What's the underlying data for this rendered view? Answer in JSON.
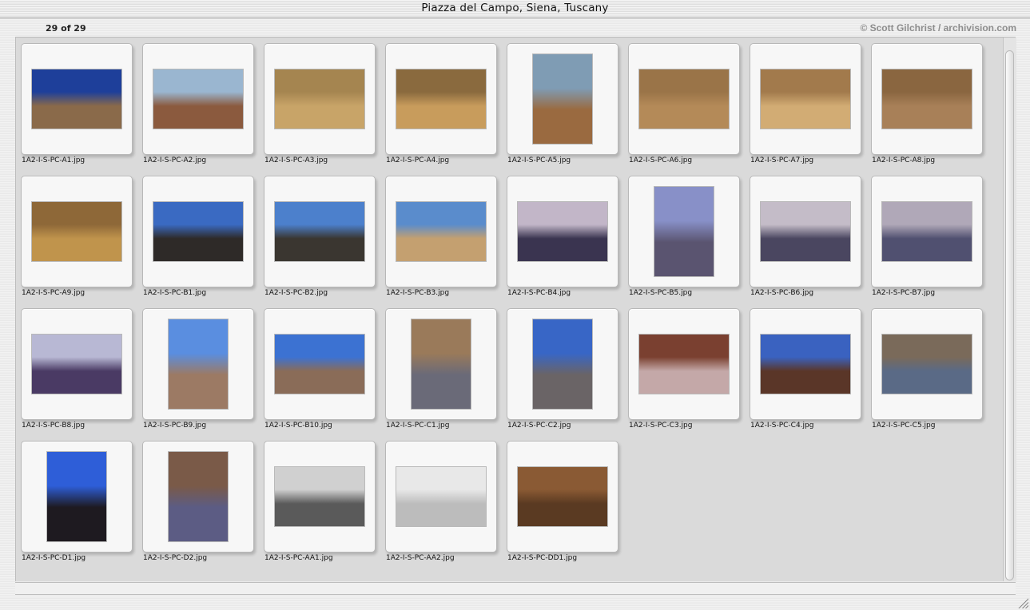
{
  "window": {
    "title": "Piazza del Campo, Siena, Tuscany"
  },
  "header": {
    "count": "29 of 29",
    "copyright": "© Scott Gilchrist / archivision.com"
  },
  "gallery": {
    "items": [
      {
        "filename": "1A2-I-S-PC-A1.jpg",
        "orientation": "landscape",
        "sky": "#1e3f9a",
        "ground": "#8a6a4a"
      },
      {
        "filename": "1A2-I-S-PC-A2.jpg",
        "orientation": "landscape",
        "sky": "#9ab6d0",
        "ground": "#8b5a3e"
      },
      {
        "filename": "1A2-I-S-PC-A3.jpg",
        "orientation": "landscape",
        "sky": "#a58550",
        "ground": "#c8a468"
      },
      {
        "filename": "1A2-I-S-PC-A4.jpg",
        "orientation": "landscape",
        "sky": "#8a6a3e",
        "ground": "#c89c5c"
      },
      {
        "filename": "1A2-I-S-PC-A5.jpg",
        "orientation": "portrait",
        "sky": "#7f9cb4",
        "ground": "#9a6a40"
      },
      {
        "filename": "1A2-I-S-PC-A6.jpg",
        "orientation": "landscape",
        "sky": "#9a7448",
        "ground": "#b48a58"
      },
      {
        "filename": "1A2-I-S-PC-A7.jpg",
        "orientation": "landscape",
        "sky": "#a27a4c",
        "ground": "#d2ac74"
      },
      {
        "filename": "1A2-I-S-PC-A8.jpg",
        "orientation": "landscape",
        "sky": "#8a6640",
        "ground": "#a88058"
      },
      {
        "filename": "1A2-I-S-PC-A9.jpg",
        "orientation": "landscape",
        "sky": "#8e6838",
        "ground": "#c0944c"
      },
      {
        "filename": "1A2-I-S-PC-B1.jpg",
        "orientation": "landscape",
        "sky": "#3a6ac2",
        "ground": "#2e2a28"
      },
      {
        "filename": "1A2-I-S-PC-B2.jpg",
        "orientation": "landscape",
        "sky": "#4c80cc",
        "ground": "#3a3630"
      },
      {
        "filename": "1A2-I-S-PC-B3.jpg",
        "orientation": "landscape",
        "sky": "#5a8ccc",
        "ground": "#c4a070"
      },
      {
        "filename": "1A2-I-S-PC-B4.jpg",
        "orientation": "landscape",
        "sky": "#c2b6c8",
        "ground": "#3a3450"
      },
      {
        "filename": "1A2-I-S-PC-B5.jpg",
        "orientation": "portrait",
        "sky": "#8890c8",
        "ground": "#5a5470"
      },
      {
        "filename": "1A2-I-S-PC-B6.jpg",
        "orientation": "landscape",
        "sky": "#c4bcc8",
        "ground": "#4a4660"
      },
      {
        "filename": "1A2-I-S-PC-B7.jpg",
        "orientation": "landscape",
        "sky": "#b0a8b8",
        "ground": "#505070"
      },
      {
        "filename": "1A2-I-S-PC-B8.jpg",
        "orientation": "landscape",
        "sky": "#b8b8d4",
        "ground": "#4a3a64"
      },
      {
        "filename": "1A2-I-S-PC-B9.jpg",
        "orientation": "portrait",
        "sky": "#5a8ee0",
        "ground": "#9c7a64"
      },
      {
        "filename": "1A2-I-S-PC-B10.jpg",
        "orientation": "landscape",
        "sky": "#3c72d2",
        "ground": "#8a6c58"
      },
      {
        "filename": "1A2-I-S-PC-C1.jpg",
        "orientation": "portrait",
        "sky": "#9a7a5a",
        "ground": "#6a6a78"
      },
      {
        "filename": "1A2-I-S-PC-C2.jpg",
        "orientation": "portrait",
        "sky": "#3866c6",
        "ground": "#6a6466"
      },
      {
        "filename": "1A2-I-S-PC-C3.jpg",
        "orientation": "landscape",
        "sky": "#7a4030",
        "ground": "#c4a8a8"
      },
      {
        "filename": "1A2-I-S-PC-C4.jpg",
        "orientation": "landscape",
        "sky": "#3a62c0",
        "ground": "#5a3628"
      },
      {
        "filename": "1A2-I-S-PC-C5.jpg",
        "orientation": "landscape",
        "sky": "#7a6a5a",
        "ground": "#5a6a86"
      },
      {
        "filename": "1A2-I-S-PC-D1.jpg",
        "orientation": "portrait",
        "sky": "#2e5ed8",
        "ground": "#1e1a20"
      },
      {
        "filename": "1A2-I-S-PC-D2.jpg",
        "orientation": "portrait",
        "sky": "#7a5a48",
        "ground": "#5c5c84"
      },
      {
        "filename": "1A2-I-S-PC-AA1.jpg",
        "orientation": "landscape",
        "sky": "#d0d0d0",
        "ground": "#5a5a5a"
      },
      {
        "filename": "1A2-I-S-PC-AA2.jpg",
        "orientation": "landscape",
        "sky": "#e8e8e8",
        "ground": "#bcbcbc"
      },
      {
        "filename": "1A2-I-S-PC-DD1.jpg",
        "orientation": "landscape",
        "sky": "#8a5a34",
        "ground": "#5a3a22"
      }
    ]
  },
  "colors": {
    "pane_background": "#dadada",
    "tile_background": "#f7f7f7",
    "copyright_text": "#8d8d8d"
  }
}
